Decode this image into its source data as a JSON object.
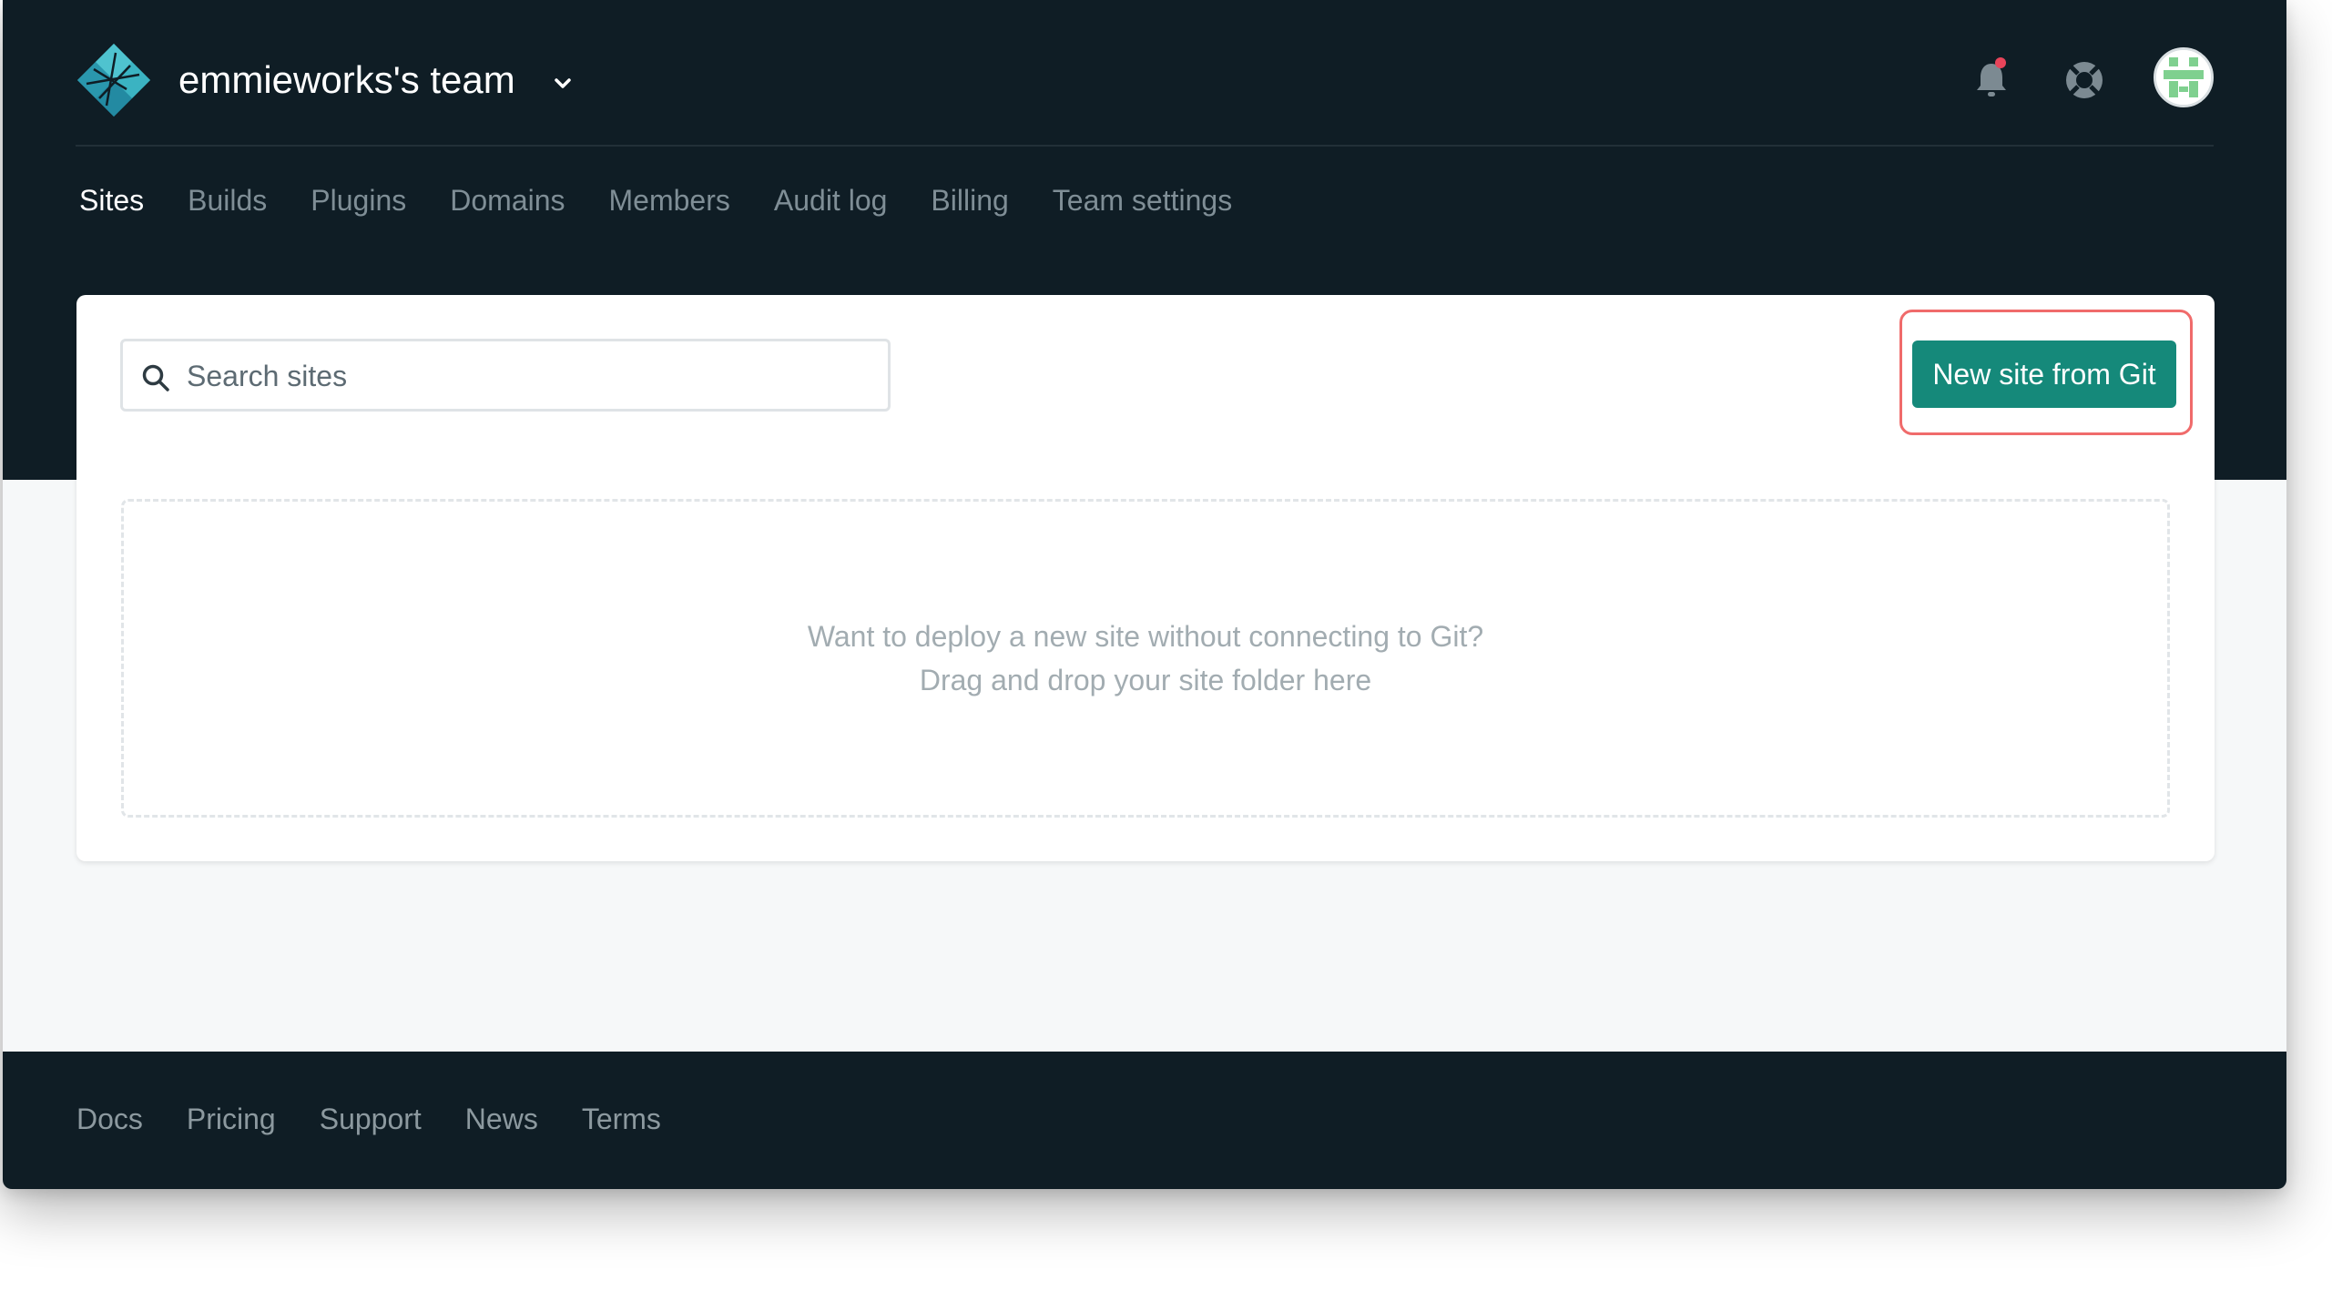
{
  "header": {
    "team_name": "emmieworks's team",
    "logo_icon": "netlify-logo-icon",
    "caret_icon": "chevron-down-icon",
    "notifications_icon": "bell-icon",
    "notification_dot_color": "#e8445a",
    "help_icon": "lifebuoy-icon",
    "avatar_icon": "user-avatar"
  },
  "tabs": [
    {
      "label": "Sites",
      "active": true
    },
    {
      "label": "Builds",
      "active": false
    },
    {
      "label": "Plugins",
      "active": false
    },
    {
      "label": "Domains",
      "active": false
    },
    {
      "label": "Members",
      "active": false
    },
    {
      "label": "Audit log",
      "active": false
    },
    {
      "label": "Billing",
      "active": false
    },
    {
      "label": "Team settings",
      "active": false
    }
  ],
  "search": {
    "placeholder": "Search sites",
    "value": "",
    "icon": "search-icon"
  },
  "actions": {
    "new_site_label": "New site from Git",
    "new_site_color": "#15897a",
    "highlight_color": "#f06b6b"
  },
  "dropzone": {
    "line1": "Want to deploy a new site without connecting to Git?",
    "line2": "Drag and drop your site folder here"
  },
  "footer": {
    "links": [
      "Docs",
      "Pricing",
      "Support",
      "News",
      "Terms"
    ]
  },
  "colors": {
    "header_bg": "#0f1d25",
    "page_bg": "#f6f8f9",
    "tab_active": "#ffffff",
    "tab_inactive": "#7f8e96"
  }
}
